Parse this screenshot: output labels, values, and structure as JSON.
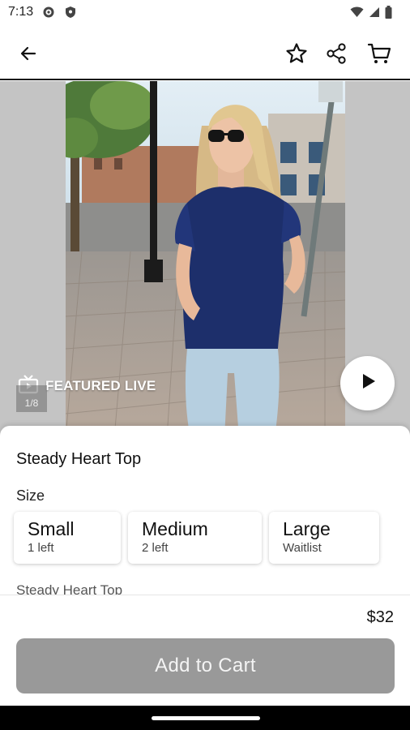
{
  "status_bar": {
    "time": "7:13",
    "icons": [
      "settings-gear-icon",
      "shield-icon",
      "wifi-icon",
      "signal-icon",
      "battery-icon"
    ]
  },
  "app_bar": {
    "icons": [
      "back-arrow-icon",
      "star-icon",
      "share-icon",
      "cart-icon"
    ]
  },
  "media": {
    "featured_label": "FEATURED LIVE",
    "counter": "1/8",
    "icons": [
      "tv-icon",
      "play-icon"
    ]
  },
  "product": {
    "title": "Steady Heart Top",
    "size_label": "Size",
    "sizes": [
      {
        "name": "Small",
        "status": "1 left"
      },
      {
        "name": "Medium",
        "status": "2 left"
      },
      {
        "name": "Large",
        "status": "Waitlist"
      }
    ],
    "description": "Steady Heart Top",
    "price": "$32",
    "add_to_cart": "Add to Cart"
  },
  "colors": {
    "cta_background": "#999999",
    "media_background": "#c4c4c4",
    "shirt_navy": "#1d2f6b"
  }
}
